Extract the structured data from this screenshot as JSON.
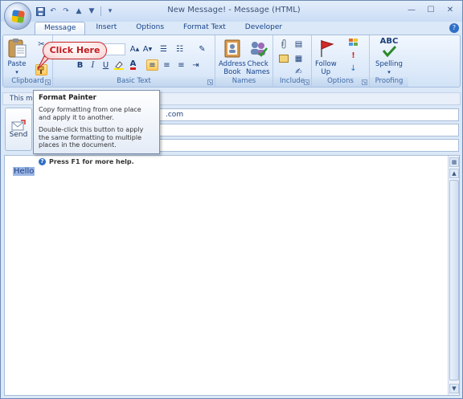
{
  "window": {
    "title": "New Message! - Message (HTML)"
  },
  "tabs": [
    {
      "label": "Message",
      "active": true
    },
    {
      "label": "Insert"
    },
    {
      "label": "Options"
    },
    {
      "label": "Format Text"
    },
    {
      "label": "Developer"
    }
  ],
  "ribbon": {
    "clipboard": {
      "label": "Clipboard",
      "paste_label": "Paste"
    },
    "basic_text": {
      "label": "Basic Text"
    },
    "names": {
      "label": "Names",
      "address_book_line1": "Address",
      "address_book_line2": "Book",
      "check_names_line1": "Check",
      "check_names_line2": "Names"
    },
    "include": {
      "label": "Include"
    },
    "options": {
      "label": "Options",
      "follow_up_line1": "Follow",
      "follow_up_line2": "Up"
    },
    "proofing": {
      "label": "Proofing",
      "spelling_label": "Spelling",
      "spelling_icon_text": "ABC"
    }
  },
  "callout": {
    "text": "Click Here"
  },
  "infobar": {
    "text": "This me"
  },
  "send": {
    "label": "Send"
  },
  "fields": {
    "to_value_tail": ".com"
  },
  "tooltip": {
    "title": "Format Painter",
    "line1": "Copy formatting from one place\nand apply it to another.",
    "line2": "Double-click this button to apply\nthe same formatting to multiple\nplaces in the document.",
    "help": "Press F1 for more help."
  },
  "editor": {
    "text": "Hello"
  },
  "colors": {
    "accent": "#c9262b",
    "ribbon_bg": "#dfebfa",
    "selection": "#9bb6e3"
  },
  "icons": [
    "office-button-icon",
    "save-icon",
    "undo-icon",
    "redo-icon",
    "up-arrow-icon",
    "down-arrow-icon",
    "help-icon",
    "paste-icon",
    "format-painter-icon",
    "bold-icon",
    "italic-icon",
    "underline-icon",
    "highlight-icon",
    "font-color-icon",
    "bullets-icon",
    "numbering-icon",
    "grow-font-icon",
    "shrink-font-icon",
    "align-left-icon",
    "align-center-icon",
    "align-right-icon",
    "address-book-icon",
    "check-names-icon",
    "attach-file-icon",
    "follow-up-flag-icon",
    "high-importance-icon",
    "low-importance-icon",
    "spelling-icon"
  ]
}
